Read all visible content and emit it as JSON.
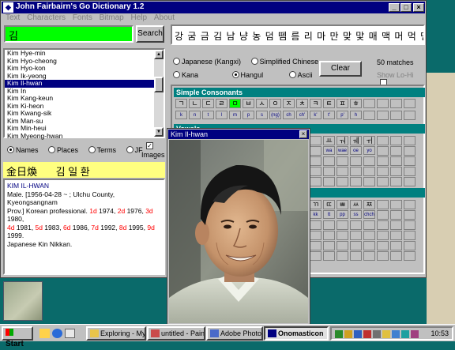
{
  "window": {
    "title": "John Fairbairn's Go Dictionary 1.2",
    "min_glyph": "_",
    "max_glyph": "□",
    "close_glyph": "×"
  },
  "menu": [
    "Text",
    "Characters",
    "Fonts",
    "Bitmap",
    "Help",
    "About"
  ],
  "search": {
    "value": "김",
    "button_label": "Search"
  },
  "char_display": "강 굼 금 김 남 냥 농 덤 뗌 름 리 마 만 맞 맟 매 맥 머 먹 먼",
  "name_list": {
    "items": [
      "Kim Hye-min",
      "Kim Hyo-cheong",
      "Kim Hyo-kon",
      "Kim Ik-yeong",
      "Kim Il-hwan",
      "Kim In",
      "Kim Kang-keun",
      "Kim Ki-heon",
      "Kim Kwang-sik",
      "Kim Man-su",
      "Kim Min-heui",
      "Kim Myeong-hwan"
    ],
    "selected_index": 4
  },
  "filters": {
    "names": "Names",
    "places": "Places",
    "terms": "Terms",
    "jf": "JF",
    "images": "Images"
  },
  "detail": {
    "banner_hanja": "金日煥",
    "banner_hangul": "김 일 환",
    "heading": "KIM IL-HWAN",
    "line1": "Male. [1956-04-28 ~ ; Ulchu County, Kyeongsangnam",
    "line2a": "Prov.] Korean professional. ",
    "r1": "1d",
    "t1": " 1974, ",
    "r2": "2d",
    "t2": " 1976, ",
    "r3": "3d",
    "t3": " 1980,",
    "r4": "4d",
    "t4": " 1981, ",
    "r5": "5d",
    "t5": " 1983, ",
    "r6": "6d",
    "t6": " 1986, ",
    "r7": "7d",
    "t7": " 1992, ",
    "r8": "8d",
    "t8": " 1995, ",
    "r9": "9d",
    "t9": " 1999.",
    "line4": "Japanese Kin Nikkan."
  },
  "script_options": {
    "japanese": "Japanese (Kangxi)",
    "simplified": "Simplified Chinese",
    "kana": "Kana",
    "hangul": "Hangul",
    "ascii": "Ascii"
  },
  "match_count": "50 matches",
  "clear_label": "Clear",
  "show_lo_hi": "Show Lo-Hi",
  "jamo": {
    "section1_title": "Simple Consonants",
    "consonants": [
      "ㄱ",
      "ㄴ",
      "ㄷ",
      "ㄹ",
      "ㅁ",
      "ㅂ",
      "ㅅ",
      "ㅇ",
      "ㅈ",
      "ㅊ",
      "ㅋ",
      "ㅌ",
      "ㅍ",
      "ㅎ"
    ],
    "consonant_roman": [
      "k",
      "n",
      "t",
      "l",
      "m",
      "p",
      "s",
      "(ng)",
      "ch",
      "ch'",
      "k'",
      "t'",
      "p'",
      "h"
    ],
    "selected_index": 4,
    "section2_title": "Vowels",
    "vowel_row": [
      "ㅛ",
      "ㅝ",
      "ㅞ",
      "ㅟ"
    ],
    "vowel_roman": [
      "wa",
      "wae",
      "oe",
      "yo"
    ],
    "section3_title": "Double Consonants",
    "double_row": [
      "ㄲ",
      "ㄸ",
      "ㅃ",
      "ㅆ",
      "ㅉ"
    ],
    "double_roman": [
      "kk",
      "tt",
      "pp",
      "ss",
      "chch"
    ]
  },
  "photo_window": {
    "title": "Kim Il-hwan",
    "close_glyph": "×"
  },
  "taskbar": {
    "start": "Start",
    "tasks": [
      "Exploring - My ...",
      "untitled - Paint",
      "Adobe Photo...",
      "Onomasticon"
    ],
    "clock": "10:53"
  }
}
